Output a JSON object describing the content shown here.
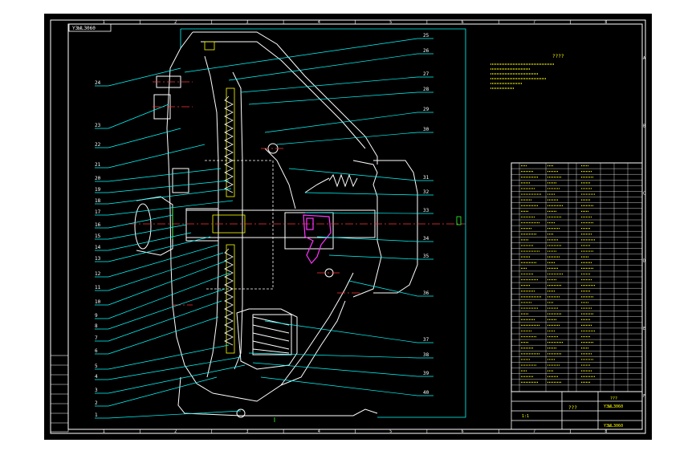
{
  "drawing": {
    "code_box": "Y3ЫL3060",
    "table_title": "????",
    "assembly_name": "???",
    "drawing_no": "Y3ЫL3060",
    "sheet_label": "???",
    "scale_label": "1:1",
    "company": "Y3ЫL3060"
  },
  "callouts_left": [
    "24",
    "23",
    "22",
    "21",
    "20",
    "19",
    "18",
    "17",
    "16",
    "15",
    "14",
    "13",
    "12",
    "11",
    "10",
    "9",
    "8",
    "7",
    "6",
    "5",
    "4",
    "3",
    "2",
    "1"
  ],
  "callouts_right": [
    "25",
    "26",
    "27",
    "28",
    "29",
    "30",
    "31",
    "32",
    "33",
    "34",
    "35",
    "36",
    "37",
    "38",
    "39",
    "40"
  ],
  "border_zones_top": [
    "1",
    "2",
    "3",
    "4",
    "5",
    "6",
    "7",
    "8"
  ],
  "border_zones_side": [
    "A",
    "B",
    "C",
    "D",
    "E",
    "F"
  ],
  "colors": {
    "frame": "#ffffff",
    "part": "#ffffff",
    "leader": "#00ffff",
    "center": "#ff3333",
    "text": "#ffffff",
    "yellow": "#ffff00",
    "magenta": "#ff33ff",
    "green": "#33ff33",
    "table": "#ffffff"
  }
}
